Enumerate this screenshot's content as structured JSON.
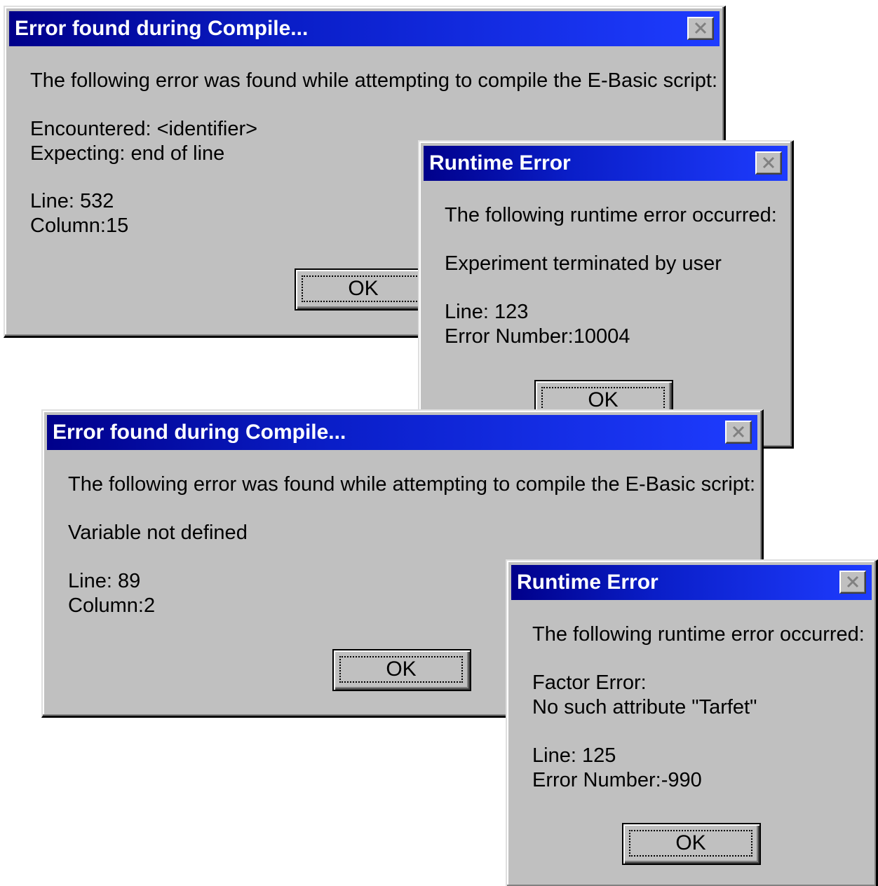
{
  "dialogs": [
    {
      "title": "Error found during Compile...",
      "intro": "The following error was found while attempting to compile the E-Basic script:",
      "detail1": "Encountered: <identifier>",
      "detail2": "Expecting: end of line",
      "line": "Line: 532",
      "extra": "Column:15",
      "ok_label": "OK"
    },
    {
      "title": "Runtime Error",
      "intro": "The following runtime error occurred:",
      "detail1": "Experiment terminated by user",
      "line": "Line: 123",
      "extra": "Error Number:10004",
      "ok_label": "OK"
    },
    {
      "title": "Error found during Compile...",
      "intro": "The following error was found while attempting to compile the E-Basic script:",
      "detail1": "Variable not defined",
      "line": "Line: 89",
      "extra": "Column:2",
      "ok_label": "OK"
    },
    {
      "title": "Runtime Error",
      "intro": "The following runtime error occurred:",
      "detail1": "Factor Error:",
      "detail2": "No such attribute \"Tarfet\"",
      "line": "Line: 125",
      "extra": "Error Number:-990",
      "ok_label": "OK"
    }
  ],
  "icons": {
    "close": "close-icon"
  }
}
